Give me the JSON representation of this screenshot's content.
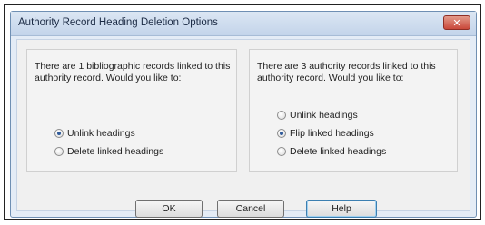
{
  "window": {
    "title": "Authority Record Heading Deletion Options",
    "close_label": "✕"
  },
  "left_group": {
    "prompt": "There are 1 bibliographic records linked to this authority record.  Would you like to:",
    "options": [
      {
        "label": "Unlink headings",
        "selected": true
      },
      {
        "label": "Delete linked headings",
        "selected": false
      }
    ]
  },
  "right_group": {
    "prompt": "There are 3 authority records linked to this authority record.  Would you like to:",
    "options": [
      {
        "label": "Unlink headings",
        "selected": false
      },
      {
        "label": "Flip linked headings",
        "selected": true
      },
      {
        "label": "Delete linked headings",
        "selected": false
      }
    ]
  },
  "buttons": {
    "ok": "OK",
    "cancel": "Cancel",
    "help": "Help"
  },
  "colors": {
    "dialog_bg": "#f0f0f0",
    "titlebar": "#c3d4ea",
    "close": "#c9483a",
    "accent": "#2f5a9a"
  },
  "icons": {
    "close": "close-icon",
    "radio": "radio-button-icon"
  }
}
